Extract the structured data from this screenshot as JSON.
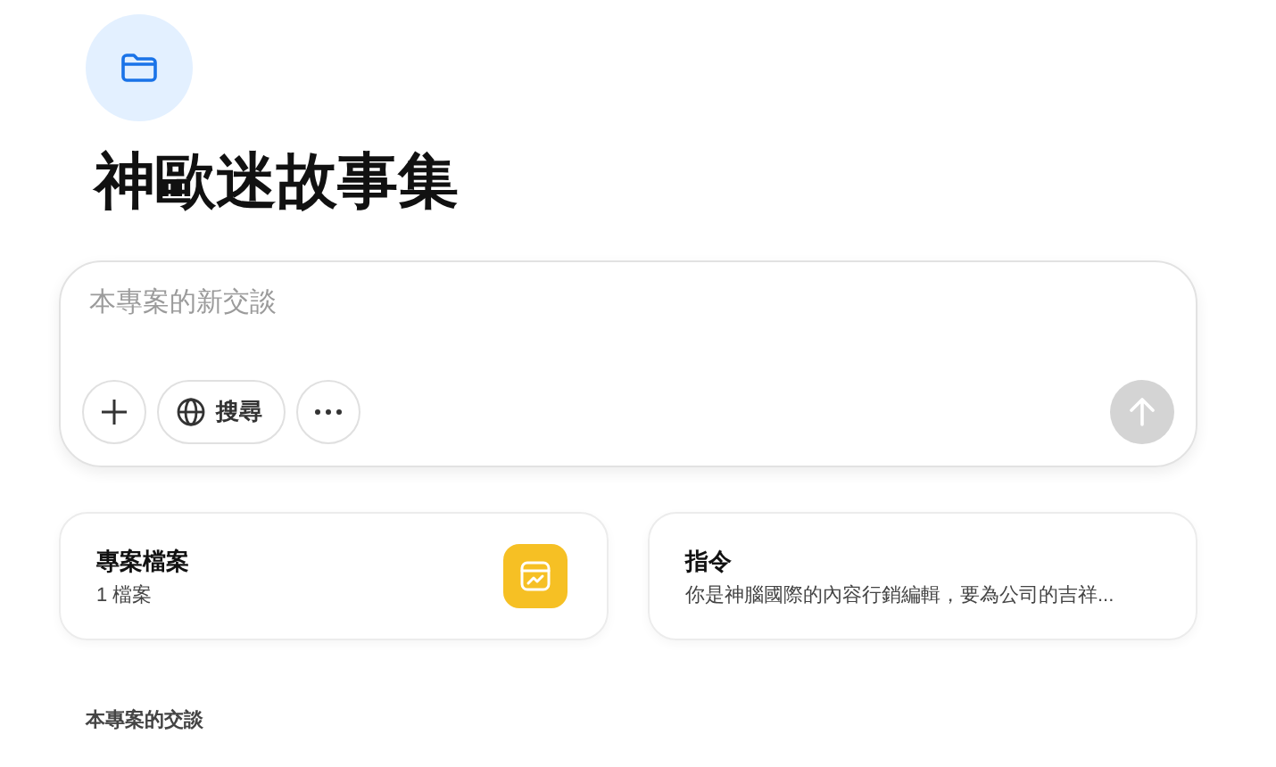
{
  "project": {
    "title": "神歐迷故事集"
  },
  "composer": {
    "placeholder": "本專案的新交談",
    "search_label": "搜尋",
    "send_disabled": true
  },
  "cards": [
    {
      "kind": "files",
      "title": "專案檔案",
      "subtitle": "1 檔案"
    },
    {
      "kind": "instructions",
      "title": "指令",
      "subtitle": "你是神腦國際的內容行銷編輯，要為公司的吉祥..."
    }
  ],
  "section": {
    "title": "本專案的交談"
  }
}
